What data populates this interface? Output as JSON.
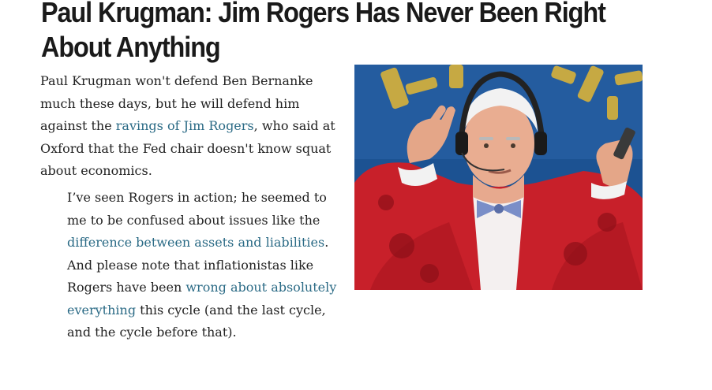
{
  "article": {
    "title": "Paul Krugman: Jim Rogers Has Never Been Right About Anything",
    "intro": {
      "before_link": "Paul Krugman won't defend Ben Bernanke much these days, but he will defend him against the ",
      "link_text": "ravings of Jim Rogers",
      "after_link": ", who said at Oxford that the Fed chair doesn't know squat about economics."
    },
    "quote": {
      "part1": "I’ve seen Rogers in action; he seemed to me to be confused about issues like the ",
      "link1": "difference between assets and liabilities",
      "part2": ". And please note that inflationistas like Rogers have been ",
      "link2": "wrong about absolutely everything",
      "part3": " this cycle (and the last cycle, and the cycle before that)."
    },
    "photo": {
      "icon": "photo-of-jim-rogers-in-red-jacket-with-headset"
    }
  },
  "colors": {
    "link": "#2a6a85",
    "text": "#222222",
    "headline": "#1a1a1a"
  }
}
